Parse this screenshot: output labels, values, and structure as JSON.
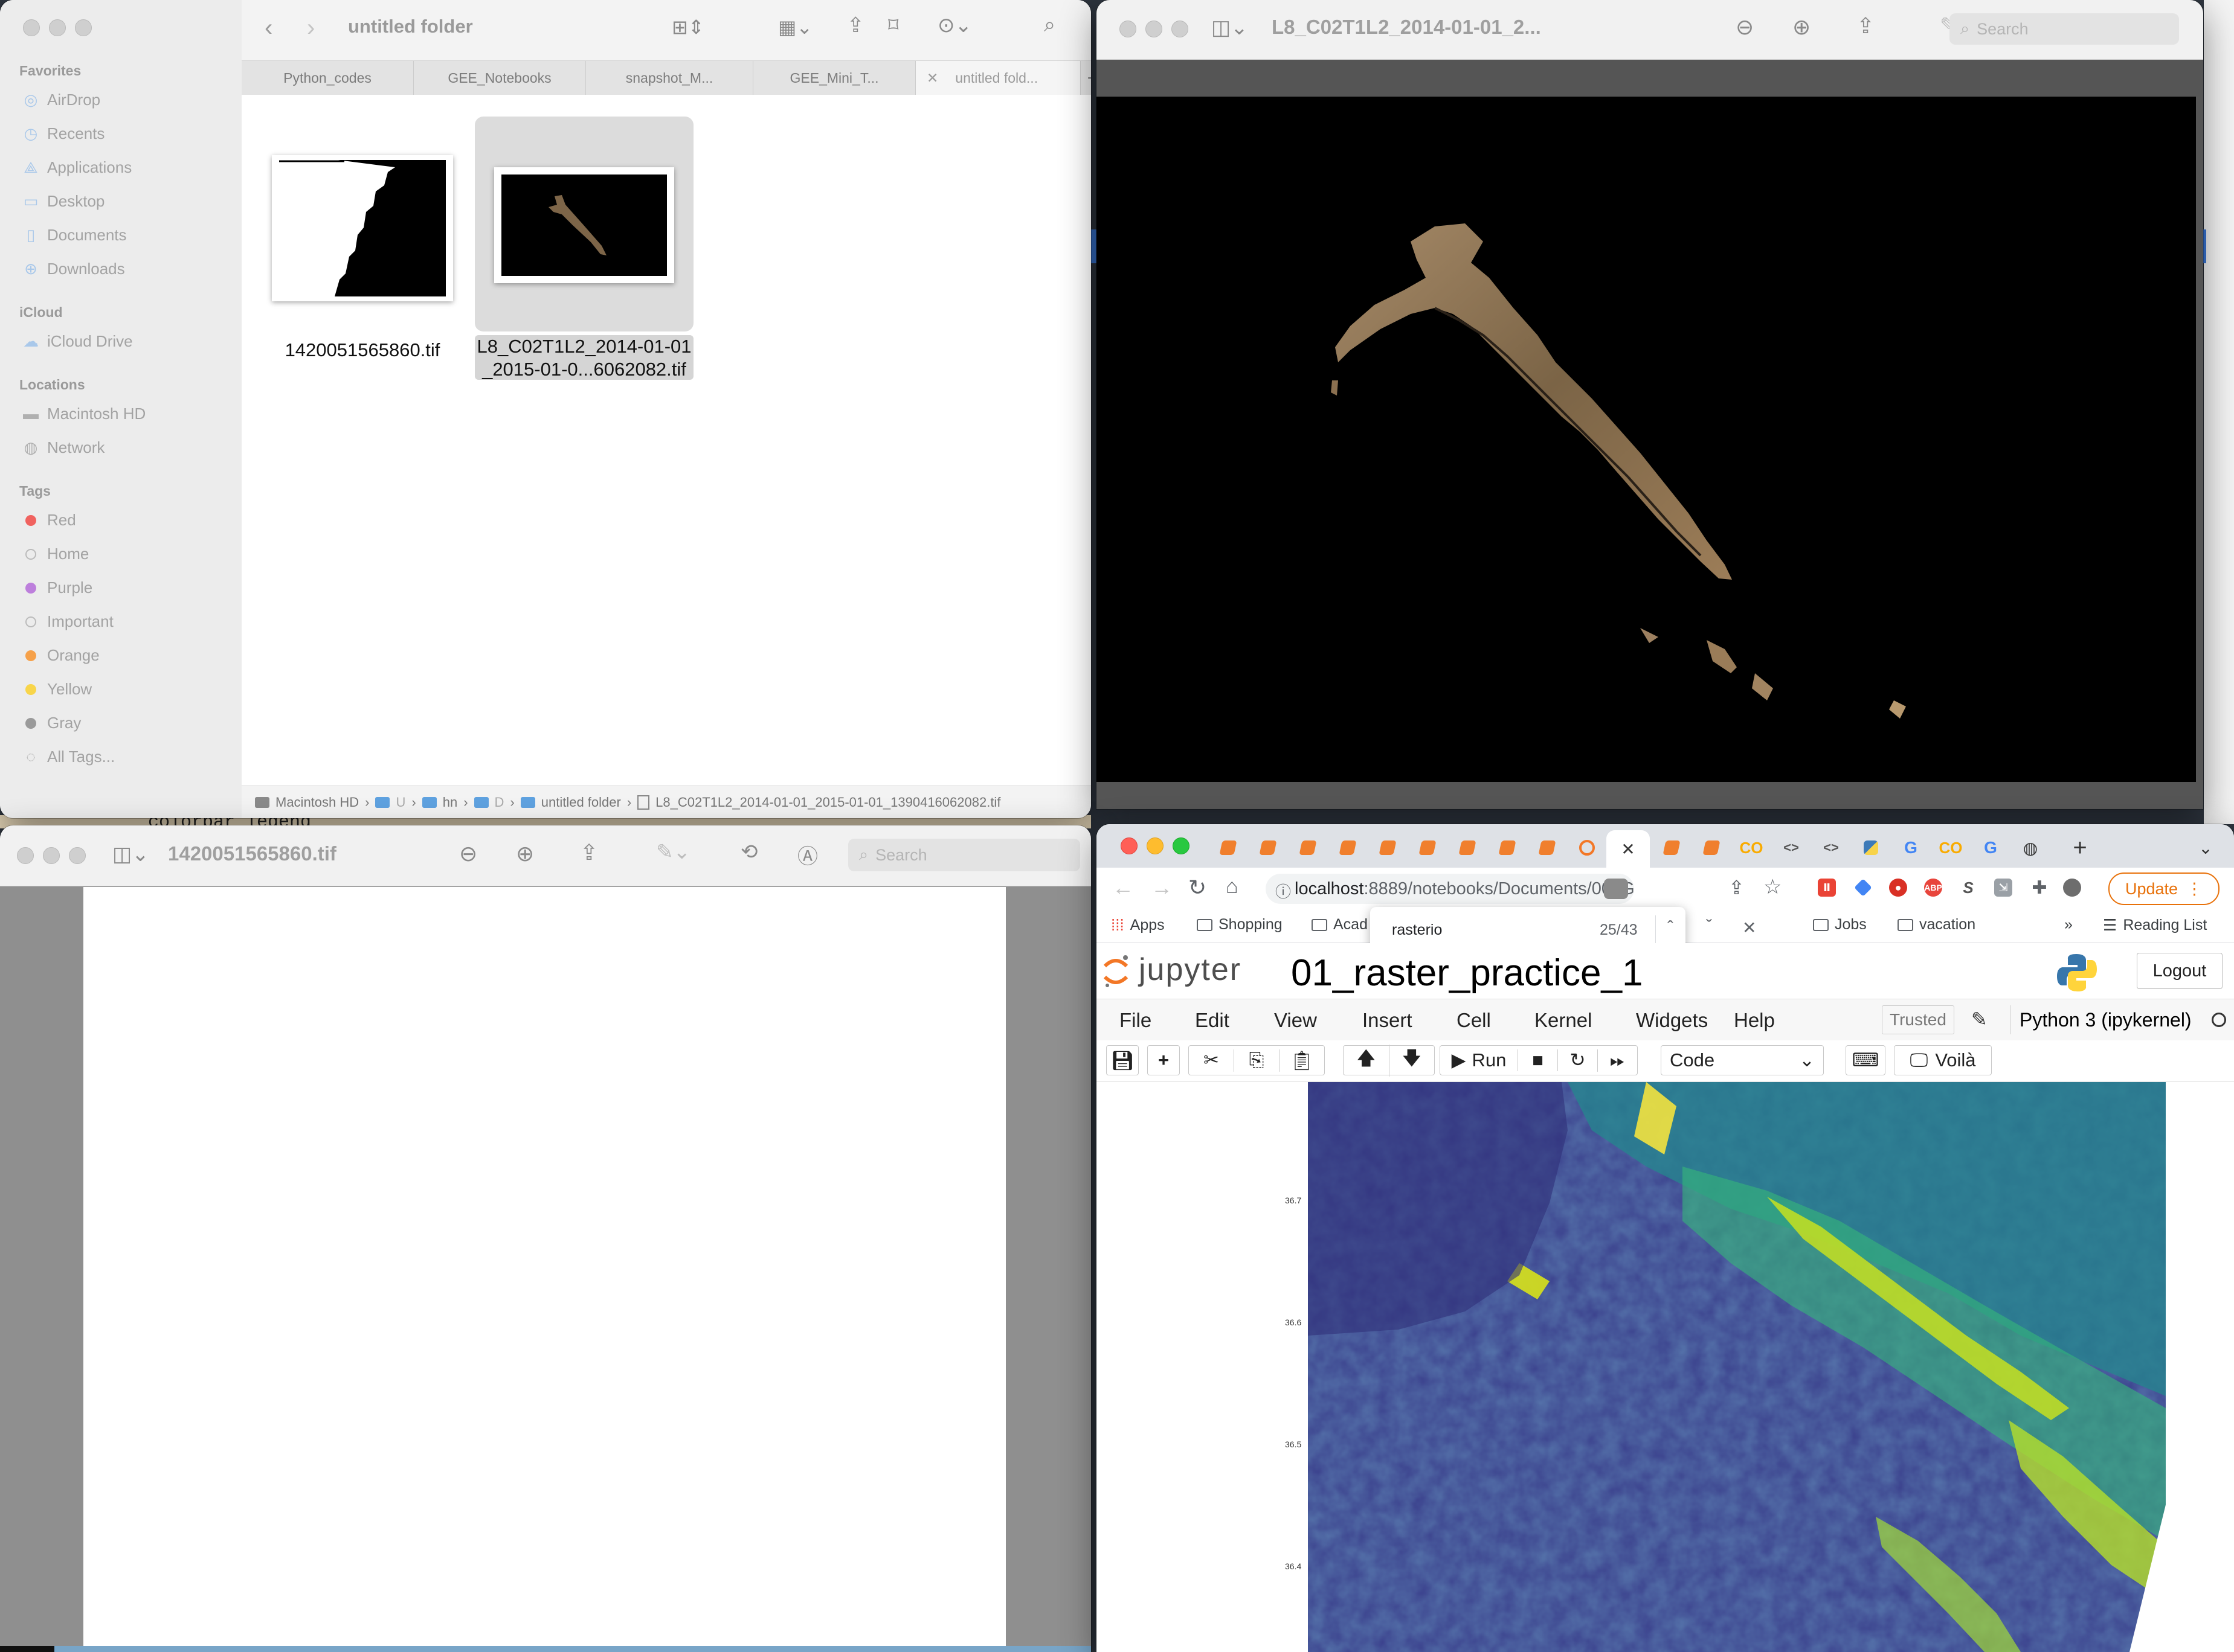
{
  "finder": {
    "title": "untitled folder",
    "sidebar": {
      "favorites_label": "Favorites",
      "favorites": [
        "AirDrop",
        "Recents",
        "Applications",
        "Desktop",
        "Documents",
        "Downloads"
      ],
      "icloud_label": "iCloud",
      "icloud": [
        "iCloud Drive"
      ],
      "locations_label": "Locations",
      "locations": [
        "Macintosh HD",
        "Network"
      ],
      "tags_label": "Tags",
      "tags": [
        {
          "name": "Red",
          "color": "#f0625f"
        },
        {
          "name": "Home",
          "color": "#ffffff"
        },
        {
          "name": "Purple",
          "color": "#bd7fdc"
        },
        {
          "name": "Important",
          "color": "#ffffff"
        },
        {
          "name": "Orange",
          "color": "#f6a14a"
        },
        {
          "name": "Yellow",
          "color": "#f8d54a"
        },
        {
          "name": "Gray",
          "color": "#9a9a9a"
        }
      ],
      "all_tags": "All Tags..."
    },
    "tabs": [
      "Python_codes",
      "GEE_Notebooks",
      "snapshot_M...",
      "GEE_Mini_T...",
      "untitled fold..."
    ],
    "files": [
      {
        "name": "1420051565860.tif"
      },
      {
        "name_line1": "L8_C02T1L2_2014-01-01",
        "name_line2": "_2015-01-0...6062082.tif"
      }
    ],
    "path": [
      "Macintosh HD",
      "U",
      "hn",
      "D",
      "untitled folder",
      "L8_C02T1L2_2014-01-01_2015-01-01_1390416062082.tif"
    ]
  },
  "preview_top": {
    "title": "L8_C02T1L2_2014-01-01_2...",
    "search_placeholder": "Search"
  },
  "preview_bottom": {
    "title": "1420051565860.tif",
    "search_placeholder": "Search"
  },
  "chrome": {
    "url_host": "localhost",
    "url_rest": ":8889/notebooks/Documents/00_G...",
    "update_label": "Update",
    "bookmarks": [
      "Apps",
      "Shopping",
      "Acad",
      "Jobs",
      "vacation"
    ],
    "reading_list": "Reading List",
    "find": {
      "query": "rasterio",
      "count": "25/43"
    }
  },
  "jupyter": {
    "logo_text": "jupyter",
    "notebook_name": "01_raster_practice_1",
    "logout": "Logout",
    "menu": [
      "File",
      "Edit",
      "View",
      "Insert",
      "Cell",
      "Kernel",
      "Widgets",
      "Help"
    ],
    "trusted": "Trusted",
    "kernel": "Python 3 (ipykernel)",
    "run_label": "Run",
    "cell_type": "Code",
    "voila_label": "Voilà",
    "plot_yticks": [
      "36.7",
      "36.6",
      "36.5",
      "36.4"
    ]
  },
  "background_text": {
    "colorbar": "colorbar legend"
  }
}
